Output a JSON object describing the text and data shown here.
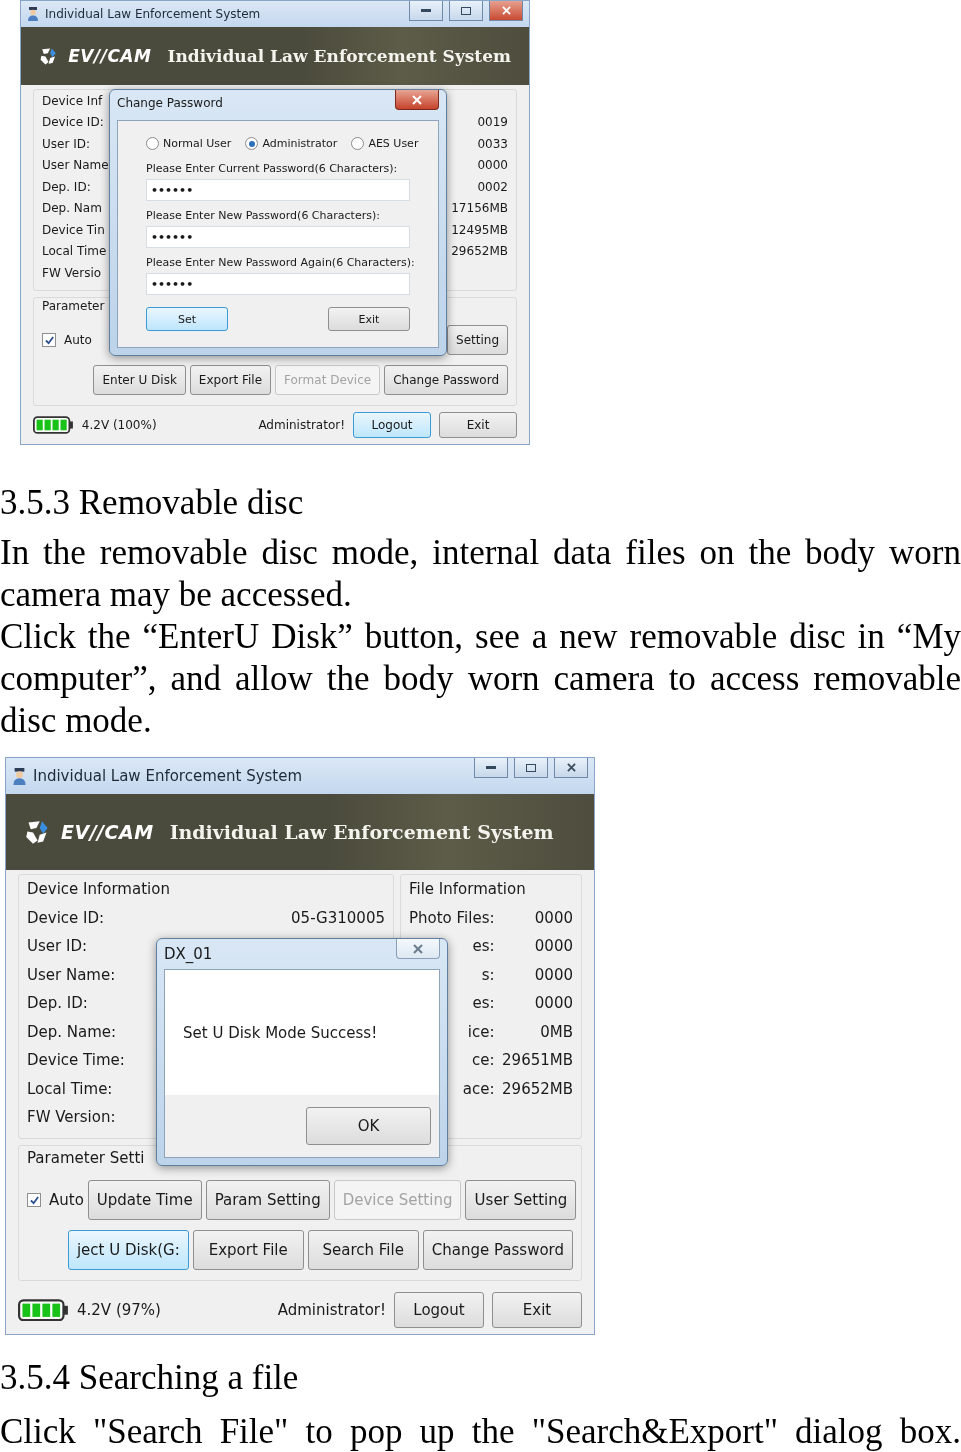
{
  "blocks": [
    {
      "kind": "screenshot",
      "window": {
        "title": "Individual Law Enforcement System"
      },
      "banner": {
        "logo": "EV//CAM",
        "title": "Individual Law Enforcement System"
      },
      "device_info": {
        "title": "Device Inf",
        "rows": [
          {
            "label": "Device ID:"
          },
          {
            "label": "User ID:"
          },
          {
            "label": "User Name"
          },
          {
            "label": "Dep. ID:"
          },
          {
            "label": "Dep. Nam"
          },
          {
            "label": "Device Tin"
          },
          {
            "label": "Local Time"
          },
          {
            "label": "FW Versio"
          }
        ]
      },
      "file_info": {
        "rows": [
          {
            "value": "0019"
          },
          {
            "value": "0033"
          },
          {
            "value": "0000"
          },
          {
            "value": "0002"
          },
          {
            "value": "17156MB"
          },
          {
            "value": "12495MB"
          },
          {
            "value": "29652MB"
          }
        ]
      },
      "parameters": {
        "title": "Parameter",
        "auto": {
          "label": "Auto",
          "checked": true
        },
        "button_rows": [
          [
            {
              "label": "Setting",
              "disabled": false,
              "highlighted": false
            }
          ],
          [
            {
              "label": "Enter U Disk",
              "disabled": false,
              "highlighted": false
            },
            {
              "label": "Export File",
              "disabled": false,
              "highlighted": false
            },
            {
              "label": "Format Device",
              "disabled": true,
              "highlighted": false
            },
            {
              "label": "Change Password",
              "disabled": false,
              "highlighted": false
            }
          ]
        ]
      },
      "status": {
        "voltage": "4.2V (100%)",
        "role": "Administrator!",
        "buttons": [
          {
            "label": "Logout",
            "disabled": false,
            "highlighted": true
          },
          {
            "label": "Exit",
            "disabled": false,
            "highlighted": false
          }
        ]
      },
      "dialog": {
        "kind": "password",
        "title": "Change Password",
        "radios": [
          {
            "label": "Normal User",
            "selected": false
          },
          {
            "label": "Administrator",
            "selected": true
          },
          {
            "label": "AES User",
            "selected": false
          }
        ],
        "fields": [
          {
            "label": "Please Enter Current Password(6 Characters):",
            "value": "••••••"
          },
          {
            "label": "Please Enter New Password(6 Characters):",
            "value": "••••••"
          },
          {
            "label": "Please Enter New Password Again(6 Characters):",
            "value": "••••••"
          }
        ],
        "buttons": [
          {
            "label": "Set",
            "disabled": false,
            "highlighted": true
          },
          {
            "label": "Exit",
            "disabled": false,
            "highlighted": false
          }
        ]
      }
    },
    {
      "kind": "section",
      "heading": "3.5.3 Removable disc",
      "paragraphs": [
        "In the removable disc mode, internal data files on the body worn camera may be accessed.",
        "Click the “EnterU Disk” button, see a new removable disc in “My computer”, and allow the body worn camera to access removable disc mode."
      ]
    },
    {
      "kind": "screenshot",
      "window": {
        "title": "Individual Law Enforcement System"
      },
      "banner": {
        "logo": "EV//CAM",
        "title": "Individual Law Enforcement System"
      },
      "device_info": {
        "title": "Device Information",
        "rows": [
          {
            "label": "Device ID:",
            "value": "05-G310005"
          },
          {
            "label": "User ID:"
          },
          {
            "label": "User Name:"
          },
          {
            "label": "Dep. ID:"
          },
          {
            "label": "Dep. Name:"
          },
          {
            "label": "Device Time:"
          },
          {
            "label": "Local Time:"
          },
          {
            "label": "FW Version:"
          }
        ]
      },
      "file_info": {
        "title": "File Information",
        "rows": [
          {
            "label": "Photo Files:",
            "value": "0000"
          },
          {
            "label": "es:",
            "value": "0000"
          },
          {
            "label": "s:",
            "value": "0000"
          },
          {
            "label": "es:",
            "value": "0000"
          },
          {
            "label": "ice:",
            "value": "0MB"
          },
          {
            "label": "ce:",
            "value": "29651MB"
          },
          {
            "label": "ace:",
            "value": "29652MB"
          }
        ]
      },
      "parameters": {
        "title": "Parameter Setti",
        "auto": {
          "label": "Auto",
          "checked": true
        },
        "button_rows": [
          [
            {
              "label": "Update Time",
              "disabled": false,
              "highlighted": false
            },
            {
              "label": "Param Setting",
              "disabled": false,
              "highlighted": false
            },
            {
              "label": "Device Setting",
              "disabled": true,
              "highlighted": false
            },
            {
              "label": "User Setting",
              "disabled": false,
              "highlighted": false
            }
          ],
          [
            {
              "label": "ject U Disk(G:",
              "disabled": false,
              "highlighted": true
            },
            {
              "label": "Export File",
              "disabled": false,
              "highlighted": false
            },
            {
              "label": "Search File",
              "disabled": false,
              "highlighted": false
            },
            {
              "label": "Change Password",
              "disabled": false,
              "highlighted": false
            }
          ]
        ]
      },
      "status": {
        "voltage": "4.2V (97%)",
        "role": "Administrator!",
        "buttons": [
          {
            "label": "Logout",
            "disabled": false,
            "highlighted": false
          },
          {
            "label": "Exit",
            "disabled": false,
            "highlighted": false
          }
        ]
      },
      "dialog": {
        "kind": "message",
        "title": "DX_01",
        "message": "Set U Disk Mode Success!",
        "buttons": [
          {
            "label": "OK",
            "disabled": false,
            "highlighted": false
          }
        ]
      }
    },
    {
      "kind": "section",
      "heading": "3.5.4 Searching a file",
      "paragraphs": [
        "Click \"Search File\" to pop up the \"Search&Export\" dialog box."
      ]
    }
  ]
}
